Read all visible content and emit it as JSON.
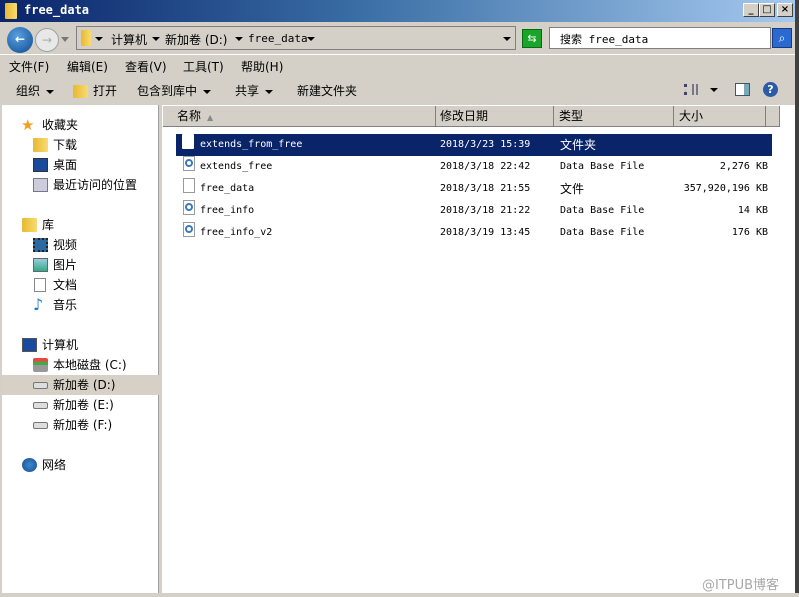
{
  "window": {
    "title": "free_data",
    "minimize": "_",
    "maximize": "□",
    "close": "×"
  },
  "address": {
    "crumbs": [
      "计算机",
      "新加卷 (D:)",
      "free_data"
    ]
  },
  "search": {
    "placeholder": "搜索 free_data"
  },
  "menu": [
    "文件(F)",
    "编辑(E)",
    "查看(V)",
    "工具(T)",
    "帮助(H)"
  ],
  "toolbar": {
    "organize": "组织",
    "open": "打开",
    "include": "包含到库中",
    "share": "共享",
    "new_folder": "新建文件夹",
    "help": "?"
  },
  "sidebar": {
    "favorites": {
      "label": "收藏夹",
      "items": [
        "下载",
        "桌面",
        "最近访问的位置"
      ]
    },
    "libraries": {
      "label": "库",
      "items": [
        "视频",
        "图片",
        "文档",
        "音乐"
      ]
    },
    "computer": {
      "label": "计算机",
      "items": [
        "本地磁盘 (C:)",
        "新加卷 (D:)",
        "新加卷 (E:)",
        "新加卷 (F:)"
      ],
      "selected": "新加卷 (D:)"
    },
    "network": {
      "label": "网络"
    }
  },
  "columns": [
    "名称",
    "修改日期",
    "类型",
    "大小"
  ],
  "files": [
    {
      "name": "extends_from_free",
      "date": "2018/3/23 15:39",
      "type": "文件夹",
      "size": "",
      "icon": "folder-icon",
      "selected": true
    },
    {
      "name": "extends_free",
      "date": "2018/3/18 22:42",
      "type": "Data Base File",
      "size": "2,276 KB",
      "icon": "database-file-icon"
    },
    {
      "name": "free_data",
      "date": "2018/3/18 21:55",
      "type": "文件",
      "size": "357,920,196 KB",
      "icon": "file-icon"
    },
    {
      "name": "free_info",
      "date": "2018/3/18 21:22",
      "type": "Data Base File",
      "size": "14 KB",
      "icon": "database-file-icon"
    },
    {
      "name": "free_info_v2",
      "date": "2018/3/19 13:45",
      "type": "Data Base File",
      "size": "176 KB",
      "icon": "database-file-icon"
    }
  ],
  "watermark": "@ITPUB博客",
  "colors": {
    "selection": "#0a246a",
    "title_start": "#0a246a",
    "title_end": "#a6caf0"
  }
}
